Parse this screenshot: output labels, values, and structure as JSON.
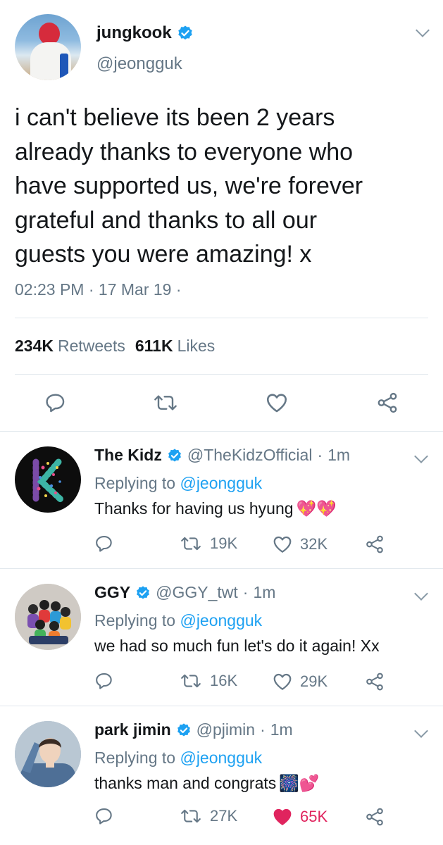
{
  "main_tweet": {
    "name": "jungkook",
    "handle": "@jeongguk",
    "text_lines": [
      "i can't believe its been 2 years",
      "already thanks to everyone who",
      "have supported us, we're forever",
      "grateful and thanks to all our",
      "guests you were amazing! x"
    ],
    "time": "02:23 PM",
    "date": "17 Mar 19",
    "retweets_count": "234K",
    "retweets_label": "Retweets",
    "likes_count": "611K",
    "likes_label": "Likes"
  },
  "replies": [
    {
      "name": "The Kidz",
      "handle": "@TheKidzOfficial",
      "time": "1m",
      "replying_prefix": "Replying to",
      "replying_to": "@jeongguk",
      "text": "Thanks for having us hyung",
      "emoji": "💖💖",
      "retweets": "19K",
      "likes": "32K",
      "liked": false
    },
    {
      "name": "GGY",
      "handle": "@GGY_twt",
      "time": "1m",
      "replying_prefix": "Replying to",
      "replying_to": "@jeongguk",
      "text": "we had so much fun let's do it again! Xx",
      "emoji": "",
      "retweets": "16K",
      "likes": "29K",
      "liked": false
    },
    {
      "name": "park jimin",
      "handle": "@pjimin",
      "time": "1m",
      "replying_prefix": "Replying to",
      "replying_to": "@jeongguk",
      "text": "thanks man and congrats",
      "emoji": "🎆💕",
      "retweets": "27K",
      "likes": "65K",
      "liked": true
    }
  ],
  "colors": {
    "verified": "#1da1f2",
    "link": "#1da1f2",
    "secondary_text": "#657786",
    "like_active": "#e0245e"
  },
  "icons": [
    "verified-icon",
    "chevron-down-icon",
    "reply-icon",
    "retweet-icon",
    "like-icon",
    "share-icon"
  ]
}
